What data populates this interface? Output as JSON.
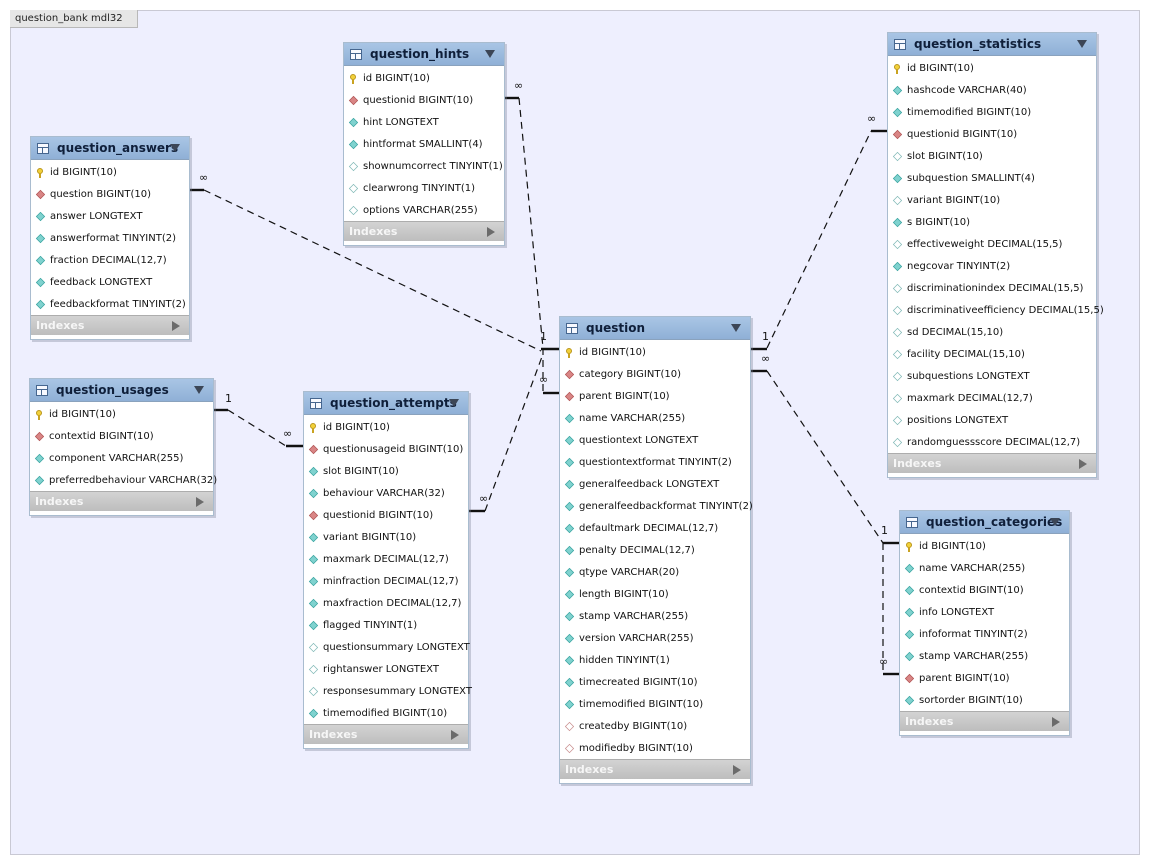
{
  "diagram": {
    "tab_title": "question_bank mdl32"
  },
  "tables": {
    "question_hints": {
      "name": "question_hints",
      "columns": [
        {
          "text": "id BIGINT(10)",
          "icon": "primary-key-icon"
        },
        {
          "text": "questionid BIGINT(10)",
          "icon": "foreign-key-icon"
        },
        {
          "text": "hint LONGTEXT",
          "icon": "not-null-column-icon"
        },
        {
          "text": "hintformat SMALLINT(4)",
          "icon": "not-null-column-icon"
        },
        {
          "text": "shownumcorrect TINYINT(1)",
          "icon": "nullable-column-icon"
        },
        {
          "text": "clearwrong TINYINT(1)",
          "icon": "nullable-column-icon"
        },
        {
          "text": "options VARCHAR(255)",
          "icon": "nullable-column-icon"
        }
      ],
      "indexes_label": "Indexes"
    },
    "question_answers": {
      "name": "question_answers",
      "columns": [
        {
          "text": "id BIGINT(10)",
          "icon": "primary-key-icon"
        },
        {
          "text": "question BIGINT(10)",
          "icon": "foreign-key-icon"
        },
        {
          "text": "answer LONGTEXT",
          "icon": "not-null-column-icon"
        },
        {
          "text": "answerformat TINYINT(2)",
          "icon": "not-null-column-icon"
        },
        {
          "text": "fraction DECIMAL(12,7)",
          "icon": "not-null-column-icon"
        },
        {
          "text": "feedback LONGTEXT",
          "icon": "not-null-column-icon"
        },
        {
          "text": "feedbackformat TINYINT(2)",
          "icon": "not-null-column-icon"
        }
      ],
      "indexes_label": "Indexes"
    },
    "question_usages": {
      "name": "question_usages",
      "columns": [
        {
          "text": "id BIGINT(10)",
          "icon": "primary-key-icon"
        },
        {
          "text": "contextid BIGINT(10)",
          "icon": "foreign-key-icon"
        },
        {
          "text": "component VARCHAR(255)",
          "icon": "not-null-column-icon"
        },
        {
          "text": "preferredbehaviour VARCHAR(32)",
          "icon": "not-null-column-icon"
        }
      ],
      "indexes_label": "Indexes"
    },
    "question_attempts": {
      "name": "question_attempts",
      "columns": [
        {
          "text": "id BIGINT(10)",
          "icon": "primary-key-icon"
        },
        {
          "text": "questionusageid BIGINT(10)",
          "icon": "foreign-key-icon"
        },
        {
          "text": "slot BIGINT(10)",
          "icon": "not-null-column-icon"
        },
        {
          "text": "behaviour VARCHAR(32)",
          "icon": "not-null-column-icon"
        },
        {
          "text": "questionid BIGINT(10)",
          "icon": "foreign-key-icon"
        },
        {
          "text": "variant BIGINT(10)",
          "icon": "not-null-column-icon"
        },
        {
          "text": "maxmark DECIMAL(12,7)",
          "icon": "not-null-column-icon"
        },
        {
          "text": "minfraction DECIMAL(12,7)",
          "icon": "not-null-column-icon"
        },
        {
          "text": "maxfraction DECIMAL(12,7)",
          "icon": "not-null-column-icon"
        },
        {
          "text": "flagged TINYINT(1)",
          "icon": "not-null-column-icon"
        },
        {
          "text": "questionsummary LONGTEXT",
          "icon": "nullable-column-icon"
        },
        {
          "text": "rightanswer LONGTEXT",
          "icon": "nullable-column-icon"
        },
        {
          "text": "responsesummary LONGTEXT",
          "icon": "nullable-column-icon"
        },
        {
          "text": "timemodified BIGINT(10)",
          "icon": "not-null-column-icon"
        }
      ],
      "indexes_label": "Indexes"
    },
    "question": {
      "name": "question",
      "columns": [
        {
          "text": "id BIGINT(10)",
          "icon": "primary-key-icon"
        },
        {
          "text": "category BIGINT(10)",
          "icon": "foreign-key-icon"
        },
        {
          "text": "parent BIGINT(10)",
          "icon": "foreign-key-icon"
        },
        {
          "text": "name VARCHAR(255)",
          "icon": "not-null-column-icon"
        },
        {
          "text": "questiontext LONGTEXT",
          "icon": "not-null-column-icon"
        },
        {
          "text": "questiontextformat TINYINT(2)",
          "icon": "not-null-column-icon"
        },
        {
          "text": "generalfeedback LONGTEXT",
          "icon": "not-null-column-icon"
        },
        {
          "text": "generalfeedbackformat TINYINT(2)",
          "icon": "not-null-column-icon"
        },
        {
          "text": "defaultmark DECIMAL(12,7)",
          "icon": "not-null-column-icon"
        },
        {
          "text": "penalty DECIMAL(12,7)",
          "icon": "not-null-column-icon"
        },
        {
          "text": "qtype VARCHAR(20)",
          "icon": "not-null-column-icon"
        },
        {
          "text": "length BIGINT(10)",
          "icon": "not-null-column-icon"
        },
        {
          "text": "stamp VARCHAR(255)",
          "icon": "not-null-column-icon"
        },
        {
          "text": "version VARCHAR(255)",
          "icon": "not-null-column-icon"
        },
        {
          "text": "hidden TINYINT(1)",
          "icon": "not-null-column-icon"
        },
        {
          "text": "timecreated BIGINT(10)",
          "icon": "not-null-column-icon"
        },
        {
          "text": "timemodified BIGINT(10)",
          "icon": "not-null-column-icon"
        },
        {
          "text": "createdby BIGINT(10)",
          "icon": "nullable-foreign-key-icon"
        },
        {
          "text": "modifiedby BIGINT(10)",
          "icon": "nullable-foreign-key-icon"
        }
      ],
      "indexes_label": "Indexes"
    },
    "question_statistics": {
      "name": "question_statistics",
      "columns": [
        {
          "text": "id BIGINT(10)",
          "icon": "primary-key-icon"
        },
        {
          "text": "hashcode VARCHAR(40)",
          "icon": "not-null-column-icon"
        },
        {
          "text": "timemodified BIGINT(10)",
          "icon": "not-null-column-icon"
        },
        {
          "text": "questionid BIGINT(10)",
          "icon": "foreign-key-icon"
        },
        {
          "text": "slot BIGINT(10)",
          "icon": "nullable-column-icon"
        },
        {
          "text": "subquestion SMALLINT(4)",
          "icon": "not-null-column-icon"
        },
        {
          "text": "variant BIGINT(10)",
          "icon": "nullable-column-icon"
        },
        {
          "text": "s BIGINT(10)",
          "icon": "not-null-column-icon"
        },
        {
          "text": "effectiveweight DECIMAL(15,5)",
          "icon": "nullable-column-icon"
        },
        {
          "text": "negcovar TINYINT(2)",
          "icon": "not-null-column-icon"
        },
        {
          "text": "discriminationindex DECIMAL(15,5)",
          "icon": "nullable-column-icon"
        },
        {
          "text": "discriminativeefficiency DECIMAL(15,5)",
          "icon": "nullable-column-icon"
        },
        {
          "text": "sd DECIMAL(15,10)",
          "icon": "nullable-column-icon"
        },
        {
          "text": "facility DECIMAL(15,10)",
          "icon": "nullable-column-icon"
        },
        {
          "text": "subquestions LONGTEXT",
          "icon": "nullable-column-icon"
        },
        {
          "text": "maxmark DECIMAL(12,7)",
          "icon": "nullable-column-icon"
        },
        {
          "text": "positions LONGTEXT",
          "icon": "nullable-column-icon"
        },
        {
          "text": "randomguessscore DECIMAL(12,7)",
          "icon": "nullable-column-icon"
        }
      ],
      "indexes_label": "Indexes"
    },
    "question_categories": {
      "name": "question_categories",
      "columns": [
        {
          "text": "id BIGINT(10)",
          "icon": "primary-key-icon"
        },
        {
          "text": "name VARCHAR(255)",
          "icon": "not-null-column-icon"
        },
        {
          "text": "contextid BIGINT(10)",
          "icon": "not-null-column-icon"
        },
        {
          "text": "info LONGTEXT",
          "icon": "not-null-column-icon"
        },
        {
          "text": "infoformat TINYINT(2)",
          "icon": "not-null-column-icon"
        },
        {
          "text": "stamp VARCHAR(255)",
          "icon": "not-null-column-icon"
        },
        {
          "text": "parent BIGINT(10)",
          "icon": "foreign-key-icon"
        },
        {
          "text": "sortorder BIGINT(10)",
          "icon": "not-null-column-icon"
        }
      ],
      "indexes_label": "Indexes"
    }
  },
  "cardinality": {
    "one": "1",
    "many": "∞"
  },
  "colors": {
    "canvas_background": "#eeeffe",
    "table_header": "#9dbbe0",
    "indexes_bar": "#c8c8c8",
    "primary_key": "#f2d13a",
    "foreign_key": "#d98585",
    "not_null_column": "#7fd2cf"
  }
}
